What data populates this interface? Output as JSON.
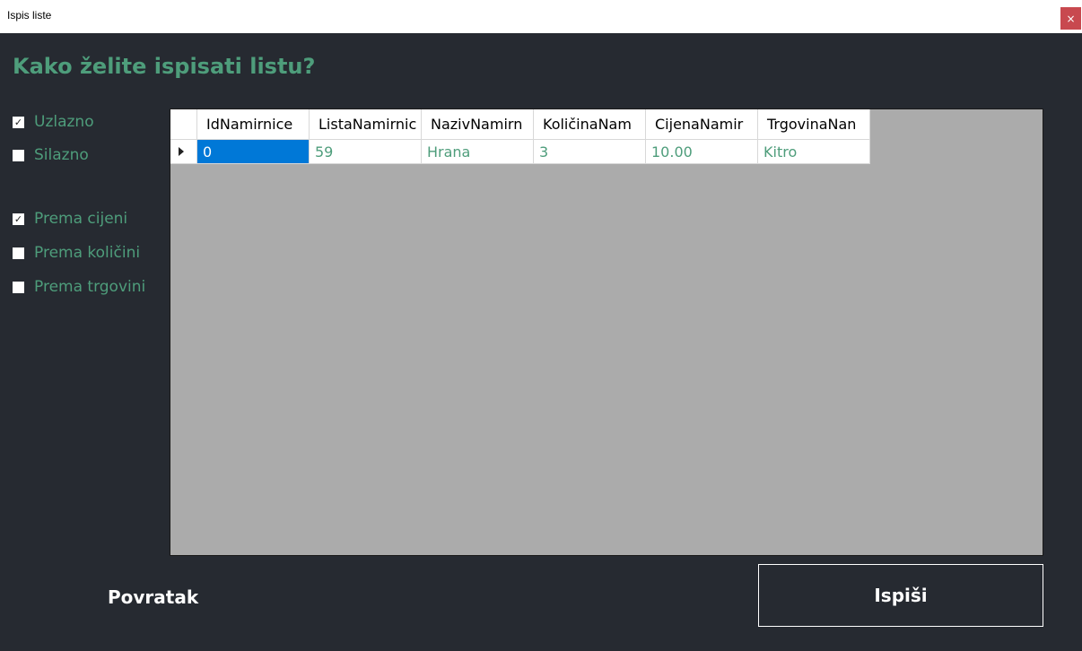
{
  "window": {
    "title": "Ispis liste",
    "close_glyph": "×"
  },
  "heading": "Kako želite ispisati listu?",
  "order_options": [
    {
      "label": "Uzlazno",
      "checked": true
    },
    {
      "label": "Silazno",
      "checked": false
    }
  ],
  "sort_options": [
    {
      "label": "Prema cijeni",
      "checked": true
    },
    {
      "label": "Prema količini",
      "checked": false
    },
    {
      "label": "Prema trgovini",
      "checked": false
    }
  ],
  "grid": {
    "columns": [
      "IdNamirnice",
      "ListaNamirnic",
      "NazivNamirn",
      "KoličinaNam",
      "CijenaNamir",
      "TrgovinaNan"
    ],
    "rows": [
      [
        "0",
        "59",
        "Hrana",
        "3",
        "10.00",
        "Kitro"
      ]
    ]
  },
  "buttons": {
    "back_label": "Povratak",
    "print_label": "Ispiši"
  },
  "colors": {
    "accent": "#4e9d7b",
    "background": "#262a31",
    "selection": "#0078d7",
    "close": "#c8494f"
  }
}
